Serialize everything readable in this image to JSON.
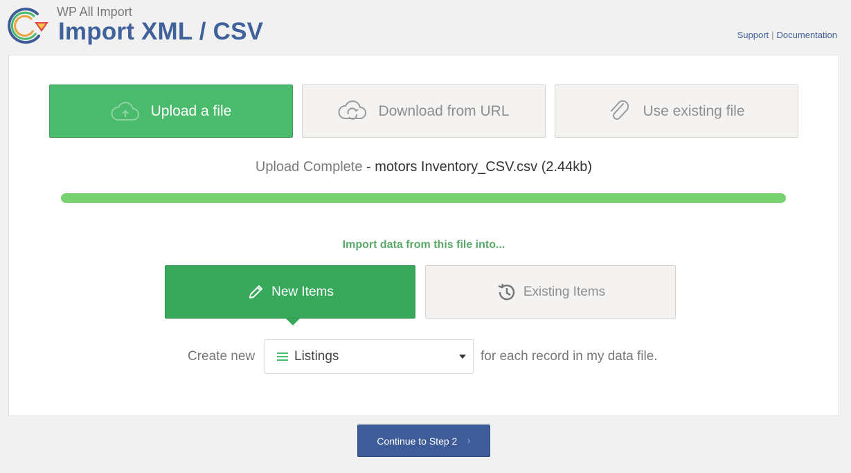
{
  "header": {
    "subtitle": "WP All Import",
    "title": "Import XML / CSV",
    "links": {
      "support": "Support",
      "separator": "|",
      "documentation": "Documentation"
    }
  },
  "sources": [
    {
      "label": "Upload a file",
      "icon": "cloud-upload-icon",
      "active": true
    },
    {
      "label": "Download from URL",
      "icon": "cloud-sync-icon",
      "active": false
    },
    {
      "label": "Use existing file",
      "icon": "paperclip-icon",
      "active": false
    }
  ],
  "upload": {
    "status_label": "Upload Complete",
    "file_info": " - motors Inventory_CSV.csv (2.44kb)",
    "progress": 1.0
  },
  "import_into": {
    "heading": "Import data from this file into...",
    "new_items": "New Items",
    "existing_items": "Existing Items"
  },
  "create": {
    "prefix": "Create new",
    "post_type": "Listings",
    "suffix": "for each record in my data file."
  },
  "continue_button": {
    "label": "Continue to Step 2",
    "chevron": "›"
  },
  "colors": {
    "brand_blue": "#40629a",
    "active_green": "#4aba6c",
    "new_items_green": "#38a85a",
    "progress_green": "#78d26f"
  }
}
